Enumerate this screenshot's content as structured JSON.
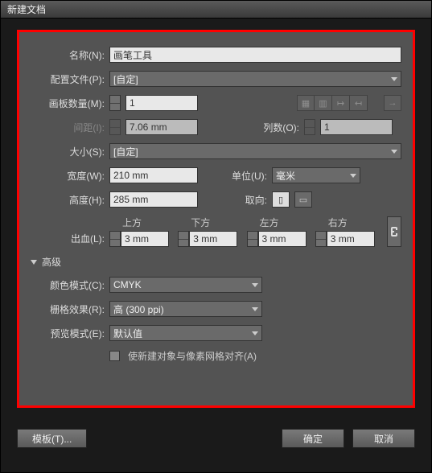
{
  "title": "新建文档",
  "name": {
    "label": "名称(N):",
    "value": "画笔工具"
  },
  "profile": {
    "label": "配置文件(P):",
    "value": "[自定]"
  },
  "artboards": {
    "label": "画板数量(M):",
    "value": "1"
  },
  "spacing": {
    "label": "间距(I):",
    "value": "7.06 mm"
  },
  "columns": {
    "label": "列数(O):",
    "value": "1"
  },
  "size": {
    "label": "大小(S):",
    "value": "[自定]"
  },
  "width": {
    "label": "宽度(W):",
    "value": "210 mm"
  },
  "units": {
    "label": "单位(U):",
    "value": "毫米"
  },
  "height": {
    "label": "高度(H):",
    "value": "285 mm"
  },
  "orientation": {
    "label": "取向:"
  },
  "bleed": {
    "label": "出血(L):",
    "top": {
      "label": "上方",
      "value": "3 mm"
    },
    "bottom": {
      "label": "下方",
      "value": "3 mm"
    },
    "left": {
      "label": "左方",
      "value": "3 mm"
    },
    "right": {
      "label": "右方",
      "value": "3 mm"
    }
  },
  "advanced": {
    "header": "高级"
  },
  "colorMode": {
    "label": "颜色模式(C):",
    "value": "CMYK"
  },
  "raster": {
    "label": "栅格效果(R):",
    "value": "高 (300 ppi)"
  },
  "preview": {
    "label": "预览模式(E):",
    "value": "默认值"
  },
  "align": {
    "label": "使新建对象与像素网格对齐(A)"
  },
  "buttons": {
    "template": "模板(T)...",
    "ok": "确定",
    "cancel": "取消"
  }
}
